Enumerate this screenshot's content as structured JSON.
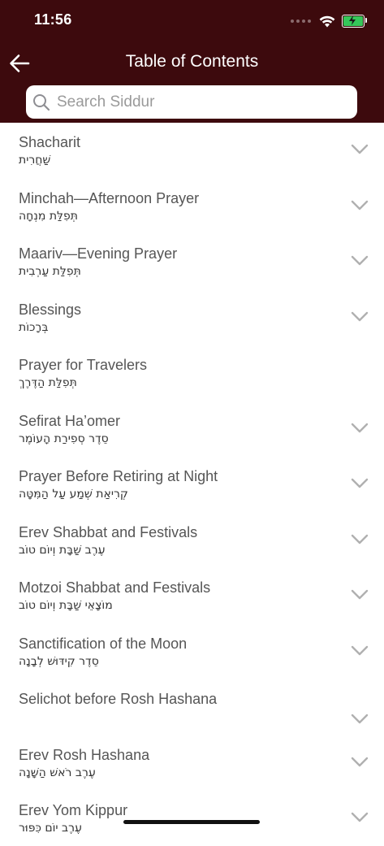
{
  "status_bar": {
    "time": "11:56"
  },
  "header": {
    "title": "Table of Contents",
    "back_icon": "arrow-left-icon"
  },
  "search": {
    "placeholder": "Search Siddur",
    "value": ""
  },
  "colors": {
    "header_bg": "#3d0a0d",
    "battery": "#35c759",
    "chevron": "#b0b0b0"
  },
  "items": [
    {
      "title": "Shacharit",
      "hebrew": "שַׁחֲרִית",
      "expandable": true
    },
    {
      "title": "Minchah—Afternoon Prayer",
      "hebrew": "תְּפִלַּת מִנְחָה",
      "expandable": true
    },
    {
      "title": "Maariv—Evening Prayer",
      "hebrew": "תְּפִלַּת עַרְבִית",
      "expandable": true
    },
    {
      "title": "Blessings",
      "hebrew": "בְּרָכוֹת",
      "expandable": true
    },
    {
      "title": "Prayer for Travelers",
      "hebrew": "תְּפִלַּת הַדֶּרֶךְ",
      "expandable": false
    },
    {
      "title": "Sefirat Ha’omer",
      "hebrew": "סֵדֶר סְפִירַת הָעוֹמֶר",
      "expandable": true
    },
    {
      "title": "Prayer Before Retiring at Night",
      "hebrew": "קְרִיאַת שְׁמַע עַל הַמִּטָּה",
      "expandable": true
    },
    {
      "title": "Erev Shabbat and Festivals",
      "hebrew": "עֶרֶב שַׁבָּת וְיוֹם טוֹב",
      "expandable": true
    },
    {
      "title": "Motzoi Shabbat and Festivals",
      "hebrew": "מוֹצָאֵי שַׁבָּת וְיוֹם טוֹב",
      "expandable": true
    },
    {
      "title": "Sanctification of the Moon",
      "hebrew": "סֵדֶר קִידּוּשׁ לְבָנָה",
      "expandable": true
    },
    {
      "title": "Selichot before Rosh Hashana",
      "hebrew": "",
      "expandable": true
    },
    {
      "title": "Erev Rosh Hashana",
      "hebrew": "עֶרֶב רֹאשׁ הַשָּׁנָה",
      "expandable": true
    },
    {
      "title": "Erev Yom Kippur",
      "hebrew": "עֶרֶב יוֹם כִּפּוּר",
      "expandable": true
    }
  ]
}
